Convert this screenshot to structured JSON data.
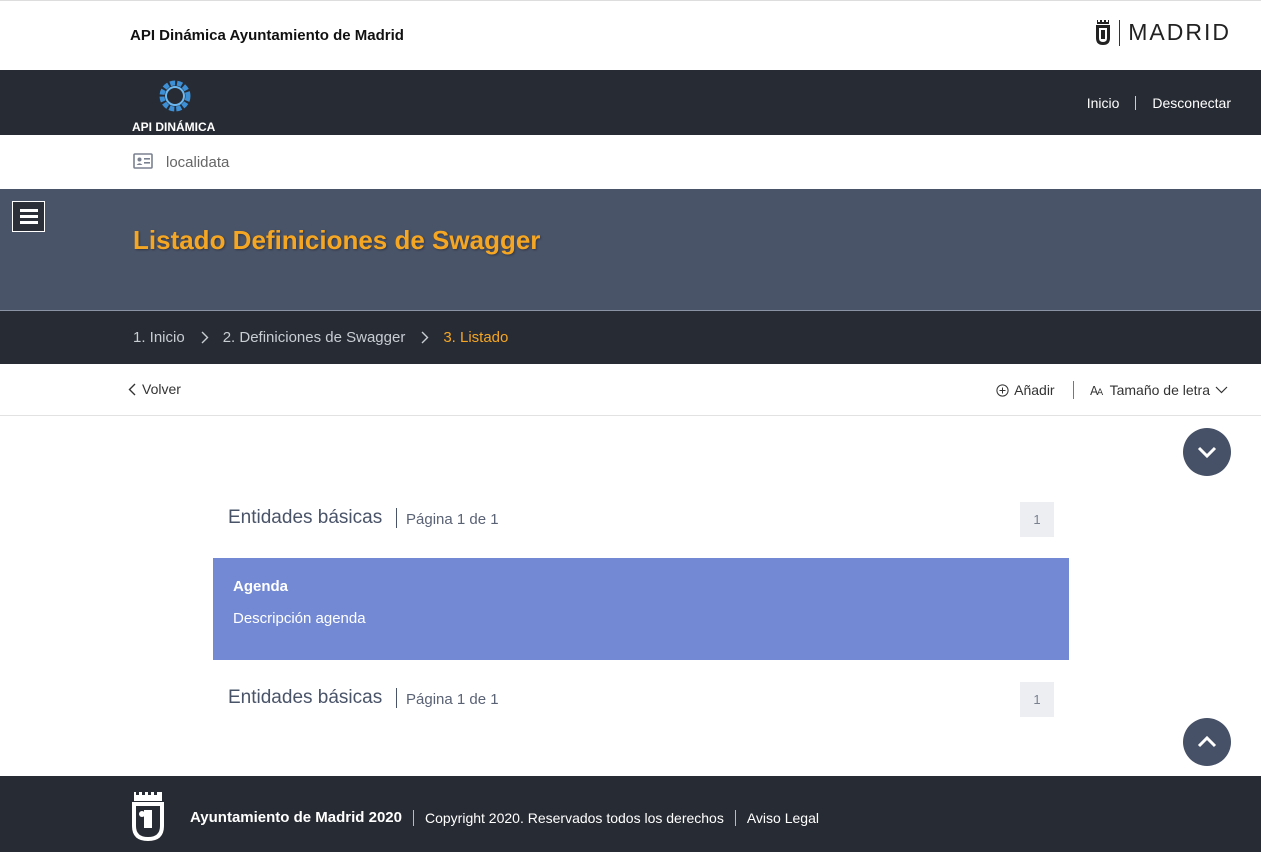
{
  "header": {
    "site_title": "API Dinámica Ayuntamiento de Madrid",
    "brand_text": "MADRID"
  },
  "nav": {
    "logo_text": "API DINÁMICA",
    "links": [
      {
        "label": "Inicio"
      },
      {
        "label": "Desconectar"
      }
    ]
  },
  "user": {
    "name": "localidata"
  },
  "hero": {
    "title": "Listado Definiciones de Swagger"
  },
  "breadcrumb": {
    "items": [
      {
        "label": "1. Inicio"
      },
      {
        "label": "2. Definiciones de Swagger"
      },
      {
        "label": "3. Listado"
      }
    ]
  },
  "actions": {
    "back_label": "Volver",
    "add_label": "Añadir",
    "font_size_label": "Tamaño de letra"
  },
  "list": {
    "top_header": {
      "title": "Entidades básicas",
      "page_info": "Página 1 de 1",
      "page_number": "1"
    },
    "items": [
      {
        "title": "Agenda",
        "description": "Descripción agenda"
      }
    ],
    "bottom_header": {
      "title": "Entidades básicas",
      "page_info": "Página 1 de 1",
      "page_number": "1"
    }
  },
  "footer": {
    "org": "Ayuntamiento de Madrid 2020",
    "copyright": "Copyright 2020. Reservados todos los derechos",
    "legal": "Aviso Legal"
  },
  "colors": {
    "dark_bar": "#272b33",
    "hero_bg": "#4a5469",
    "accent_orange": "#f5a623",
    "list_item_bg": "#7389d3"
  },
  "icons": {
    "menu": "hamburger-icon",
    "user": "id-card-icon",
    "back": "chevron-left-icon",
    "add": "plus-circle-icon",
    "font_size": "font-size-icon",
    "scroll_down": "chevron-down-icon",
    "scroll_up": "chevron-up-icon",
    "brand": "madrid-shield-icon"
  }
}
